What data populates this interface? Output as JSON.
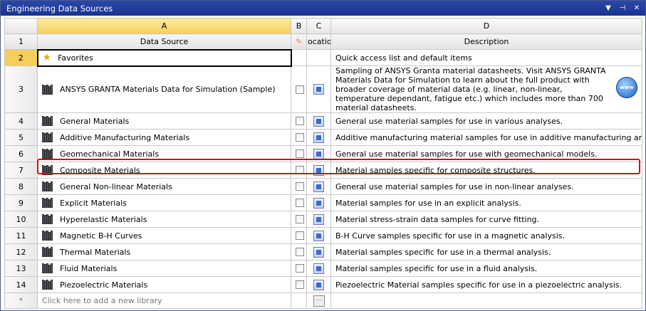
{
  "window": {
    "title": "Engineering Data Sources"
  },
  "columns": {
    "row_col": "",
    "a": "A",
    "b": "B",
    "c": "C",
    "d": "D"
  },
  "header": {
    "num": "1",
    "data_source": "Data Source",
    "location": "ocation",
    "description": "Description"
  },
  "rows": [
    {
      "num": "2",
      "name": "Favorites",
      "desc": "Quick access list and default items"
    },
    {
      "num": "3",
      "name": "ANSYS GRANTA Materials Data for Simulation (Sample)",
      "desc": "Sampling of ANSYS Granta material datasheets. Visit ANSYS GRANTA Materials Data for Simulation to learn about the full product with broader coverage of material data (e.g. linear, non-linear, temperature dependant, fatigue etc.) which includes more than 700 material datasheets.",
      "badge": "www"
    },
    {
      "num": "4",
      "name": "General Materials",
      "desc": "General use material samples for use in various analyses."
    },
    {
      "num": "5",
      "name": "Additive Manufacturing Materials",
      "desc": "Additive manufacturing material samples for use in additive manufacturing analyses."
    },
    {
      "num": "6",
      "name": "Geomechanical Materials",
      "desc": "General use material samples for use with geomechanical models."
    },
    {
      "num": "7",
      "name": "Composite Materials",
      "desc": "Material samples specific for composite structures."
    },
    {
      "num": "8",
      "name": "General Non-linear Materials",
      "desc": "General use material samples for use in non-linear analyses."
    },
    {
      "num": "9",
      "name": "Explicit Materials",
      "desc": "Material samples for use in an explicit analysis."
    },
    {
      "num": "10",
      "name": "Hyperelastic Materials",
      "desc": "Material stress-strain data samples for curve fitting."
    },
    {
      "num": "11",
      "name": "Magnetic B-H Curves",
      "desc": "B-H Curve samples specific for use in a magnetic analysis."
    },
    {
      "num": "12",
      "name": "Thermal Materials",
      "desc": "Material samples specific for use in a thermal analysis."
    },
    {
      "num": "13",
      "name": "Fluid Materials",
      "desc": "Material samples specific for use in a fluid analysis."
    },
    {
      "num": "14",
      "name": "Piezoelectric Materials",
      "desc": "Piezoelectric Material samples specific for use in a piezoelectric analysis."
    }
  ],
  "add_row": {
    "num": "*",
    "placeholder": "Click here to add a new library",
    "button": "..."
  },
  "colors": {
    "titlebar": "#2b48a6",
    "selected_header": "#f6cf5b",
    "highlight": "#c4171d"
  }
}
